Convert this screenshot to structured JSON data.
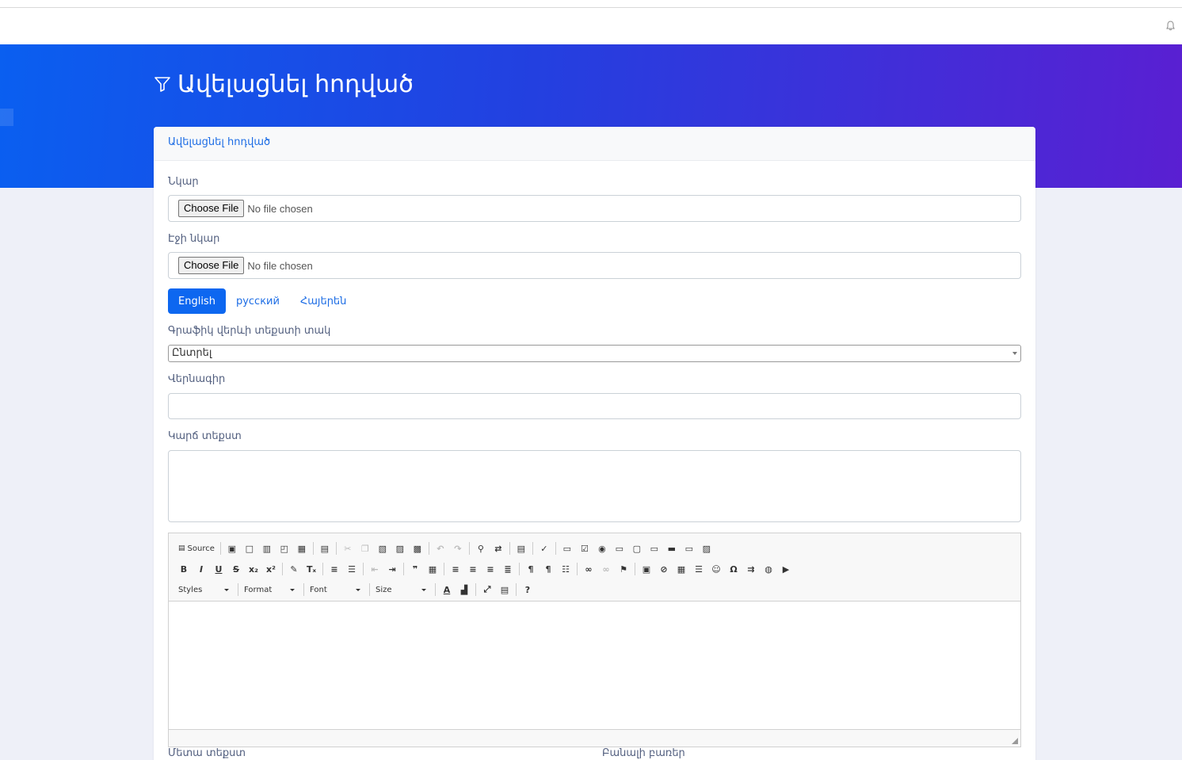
{
  "page": {
    "title": "Ավելացնել հոդված"
  },
  "card": {
    "header": "Ավելացնել հոդված",
    "image_label": "Նկար",
    "page_image_label": "Էջի նկար",
    "file_button": "Choose File",
    "file_status": "No file chosen",
    "tabs": [
      {
        "label": "English",
        "active": true
      },
      {
        "label": "русский",
        "active": false
      },
      {
        "label": "Հայերեն",
        "active": false
      }
    ],
    "graphic_label": "Գրաֆիկ վերևի տեքստի տակ",
    "graphic_select": "Ընտրել",
    "title_label": "Վերնագիր",
    "short_text_label": "Կարճ տեքստ",
    "meta_label": "Մետա տեքստ",
    "keywords_label": "Բանալի բառեր"
  },
  "editor": {
    "source_label": "Source",
    "styles_label": "Styles",
    "format_label": "Format",
    "font_label": "Font",
    "size_label": "Size",
    "help_label": "?"
  },
  "colors": {
    "accent": "#0d67f0",
    "link": "#1d6de5",
    "hero_start": "#0a5ff0",
    "hero_end": "#5a1fd2"
  }
}
